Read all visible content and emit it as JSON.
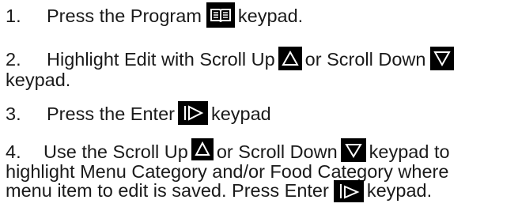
{
  "colors": {
    "text": "#1a1a1a",
    "icon_background": "#000000",
    "icon_glyph": "#ffffff"
  },
  "steps": [
    {
      "number": "1.",
      "before_icon": "Press the Program",
      "icon": "program-book-icon",
      "after_icon": "keypad."
    },
    {
      "number": "2.",
      "text_a": "Highlight Edit with Scroll Up",
      "icon_a": "scroll-up-triangle-icon",
      "text_b": "or Scroll Down",
      "icon_b": "scroll-down-triangle-icon",
      "text_c": "keypad."
    },
    {
      "number": "3.",
      "before_icon": "Press the Enter",
      "icon": "enter-play-icon",
      "after_icon": "keypad"
    },
    {
      "number": "4.",
      "text_a": "Use the Scroll Up",
      "icon_a": "scroll-up-triangle-icon",
      "text_b": "or Scroll Down",
      "icon_b": "scroll-down-triangle-icon",
      "text_c": "keypad to",
      "line2": "highlight Menu Category and/or Food Category where",
      "line3_before": "menu item to edit is saved. Press Enter",
      "icon_c": "enter-play-icon",
      "line3_after": "keypad."
    }
  ]
}
